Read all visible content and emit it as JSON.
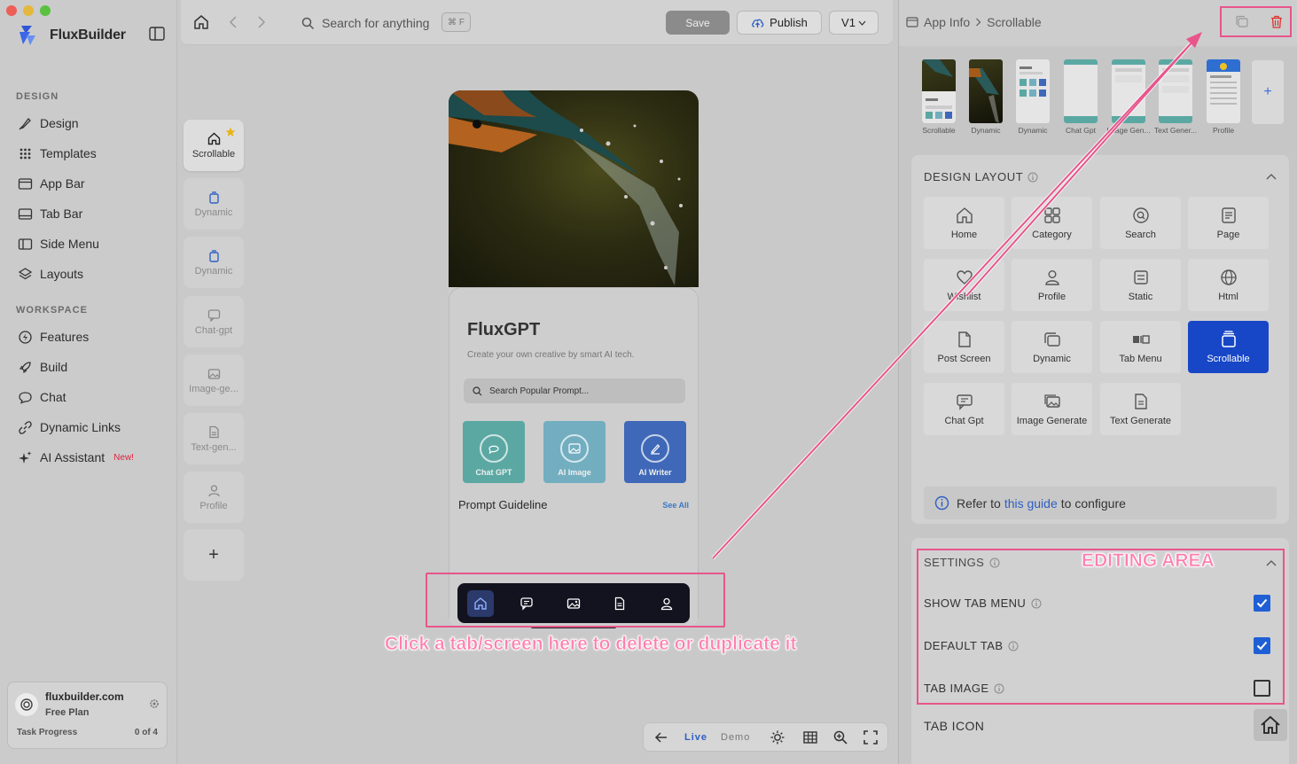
{
  "sidebar": {
    "brand": "FluxBuilder",
    "design_title": "DESIGN",
    "design_items": [
      {
        "label": "Design",
        "icon": "brush-icon"
      },
      {
        "label": "Templates",
        "icon": "grid-dots-icon"
      },
      {
        "label": "App Bar",
        "icon": "app-bar-icon"
      },
      {
        "label": "Tab Bar",
        "icon": "tab-bar-icon"
      },
      {
        "label": "Side Menu",
        "icon": "side-menu-icon"
      },
      {
        "label": "Layouts",
        "icon": "layers-icon"
      }
    ],
    "workspace_title": "WORKSPACE",
    "workspace_items": [
      {
        "label": "Features",
        "icon": "bolt-icon"
      },
      {
        "label": "Build",
        "icon": "rocket-icon"
      },
      {
        "label": "Chat",
        "icon": "chat-icon"
      },
      {
        "label": "Dynamic Links",
        "icon": "link-icon"
      },
      {
        "label": "AI Assistant",
        "icon": "sparkle-icon",
        "badge": "New!"
      }
    ],
    "account": {
      "site": "fluxbuilder.com",
      "plan": "Free Plan",
      "progress_label": "Task Progress",
      "progress_value": "0 of 4"
    }
  },
  "toolbar": {
    "search_placeholder": "Search for anything",
    "shortcut": "⌘ F",
    "save_label": "Save",
    "publish_label": "Publish",
    "version": "V1"
  },
  "screens": [
    {
      "label": "Scrollable",
      "active": true
    },
    {
      "label": "Dynamic"
    },
    {
      "label": "Dynamic"
    },
    {
      "label": "Chat-gpt"
    },
    {
      "label": "Image-ge..."
    },
    {
      "label": "Text-gen..."
    },
    {
      "label": "Profile"
    }
  ],
  "add_screen_label": "+",
  "preview": {
    "title": "FluxGPT",
    "subtitle": "Create your own creative by smart AI tech.",
    "search_placeholder": "Search Popular Prompt...",
    "features": [
      {
        "label": "Chat GPT",
        "color": "#5ba8a3"
      },
      {
        "label": "AI Image",
        "color": "#72aec0"
      },
      {
        "label": "AI Writer",
        "color": "#3f68b8"
      }
    ],
    "section_title": "Prompt Guideline",
    "see_all": "See All"
  },
  "annotations": {
    "bottom_note": "Click a tab/screen here to delete or duplicate it",
    "editing_area": "EDITING AREA"
  },
  "bottom_toolbar": {
    "live": "Live",
    "demo": "Demo"
  },
  "right_panel": {
    "breadcrumb_root": "App Info",
    "breadcrumb_current": "Scrollable",
    "thumbnails": [
      "Scrollable",
      "Dynamic",
      "Dynamic",
      "Chat Gpt",
      "Image Gen...",
      "Text Gener...",
      "Profile"
    ],
    "design_layout_title": "DESIGN LAYOUT",
    "layouts": [
      {
        "label": "Home"
      },
      {
        "label": "Category"
      },
      {
        "label": "Search"
      },
      {
        "label": "Page"
      },
      {
        "label": "Wishlist"
      },
      {
        "label": "Profile"
      },
      {
        "label": "Static"
      },
      {
        "label": "Html"
      },
      {
        "label": "Post Screen"
      },
      {
        "label": "Dynamic"
      },
      {
        "label": "Tab Menu"
      },
      {
        "label": "Scrollable",
        "active": true
      },
      {
        "label": "Chat Gpt"
      },
      {
        "label": "Image Generate"
      },
      {
        "label": "Text Generate"
      }
    ],
    "guide_prefix": "Refer to",
    "guide_link": "this guide",
    "guide_suffix": "to configure",
    "settings_title": "SETTINGS",
    "show_tab_menu": {
      "label": "SHOW TAB MENU",
      "checked": true
    },
    "default_tab": {
      "label": "DEFAULT TAB",
      "checked": true
    },
    "tab_image": {
      "label": "TAB IMAGE",
      "checked": false
    },
    "tab_icon_label": "TAB ICON"
  }
}
